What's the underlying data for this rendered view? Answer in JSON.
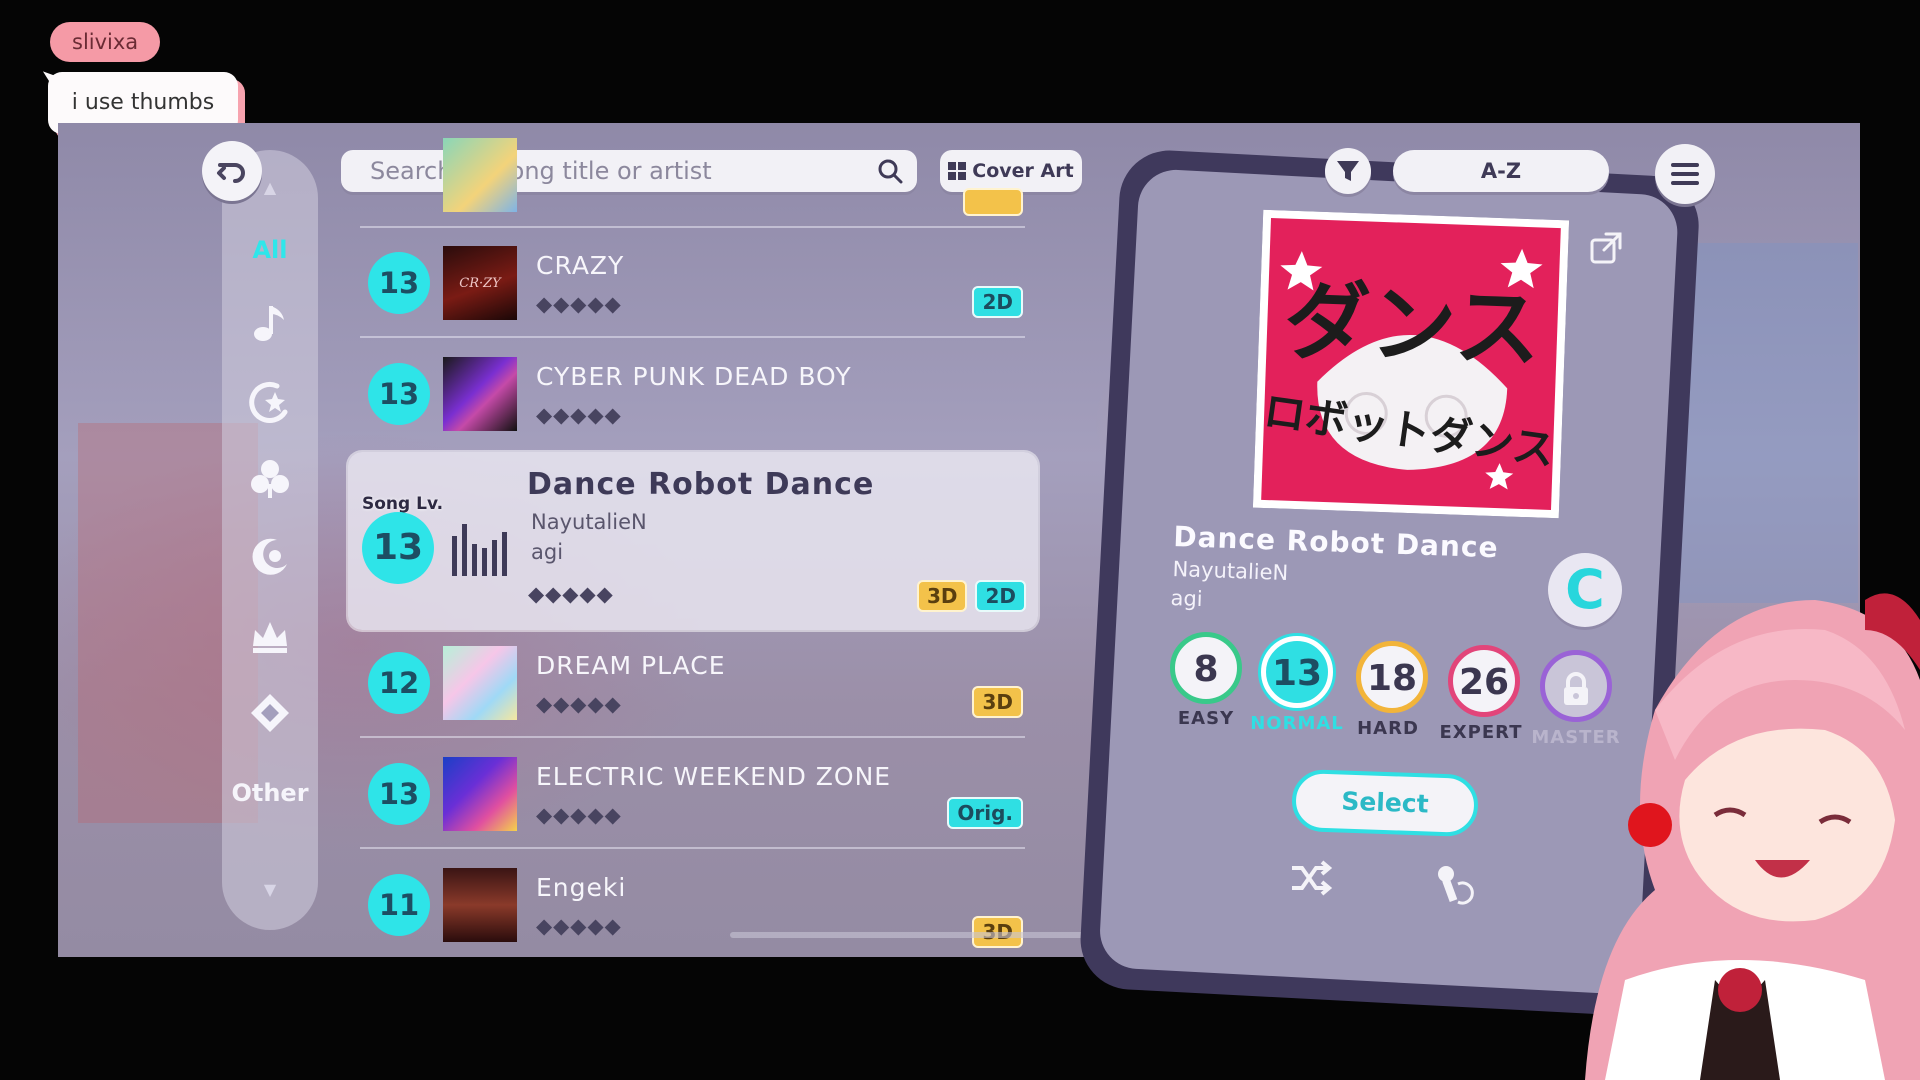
{
  "chat": {
    "username": "slivixa",
    "message": "i use thumbs"
  },
  "search": {
    "placeholder": "Search by song title or artist"
  },
  "toolbar": {
    "cover_art_label": "Cover Art",
    "sort_label": "A-Z"
  },
  "sidebar": {
    "all_label": "All",
    "other_label": "Other"
  },
  "songs": [
    {
      "level": "13",
      "title": "CRAZY",
      "dots": "◆◆◆◆◆",
      "tag": "2D"
    },
    {
      "level": "13",
      "title": "CYBER PUNK DEAD BOY",
      "dots": "◆◆◆◆◆",
      "tag": ""
    },
    {
      "level": "12",
      "title": "DREAM PLACE",
      "dots": "◆◆◆◆◆",
      "tag": "3D"
    },
    {
      "level": "13",
      "title": "ELECTRIC WEEKEND ZONE",
      "dots": "◆◆◆◆◆",
      "tag": "Orig."
    },
    {
      "level": "11",
      "title": "Engeki",
      "dots": "◆◆◆◆◆",
      "tag": "3D"
    }
  ],
  "selected_song": {
    "level_label": "Song Lv.",
    "level": "13",
    "title": "Dance Robot Dance",
    "artist": "NayutalieN",
    "author": "agi",
    "dots": "◆◆◆◆◆",
    "tags": [
      "3D",
      "2D"
    ]
  },
  "detail": {
    "title": "Dance Robot Dance",
    "artist": "NayutalieN",
    "author": "agi",
    "rank": "C",
    "select_label": "Select",
    "difficulties": [
      {
        "label": "EASY",
        "level": "8",
        "color": "#39c98a"
      },
      {
        "label": "NORMAL",
        "level": "13",
        "color": "#2fdfe3"
      },
      {
        "label": "HARD",
        "level": "18",
        "color": "#f2b43a"
      },
      {
        "label": "EXPERT",
        "level": "26",
        "color": "#e2457a"
      },
      {
        "label": "MASTER",
        "level": "",
        "color": "#9a63d6",
        "locked": true
      }
    ]
  },
  "colors": {
    "accent": "#2fdfe3",
    "tag_3d": "#f3c24a",
    "panel": "#3f395c"
  },
  "icons": [
    "back-icon",
    "music-note-icon",
    "spark-icon",
    "clover-icon",
    "moon-icon",
    "crown-icon",
    "diamond-icon",
    "search-icon",
    "grid-icon",
    "filter-icon",
    "menu-icon",
    "share-icon",
    "lock-icon",
    "shuffle-icon",
    "microphone-icon"
  ]
}
